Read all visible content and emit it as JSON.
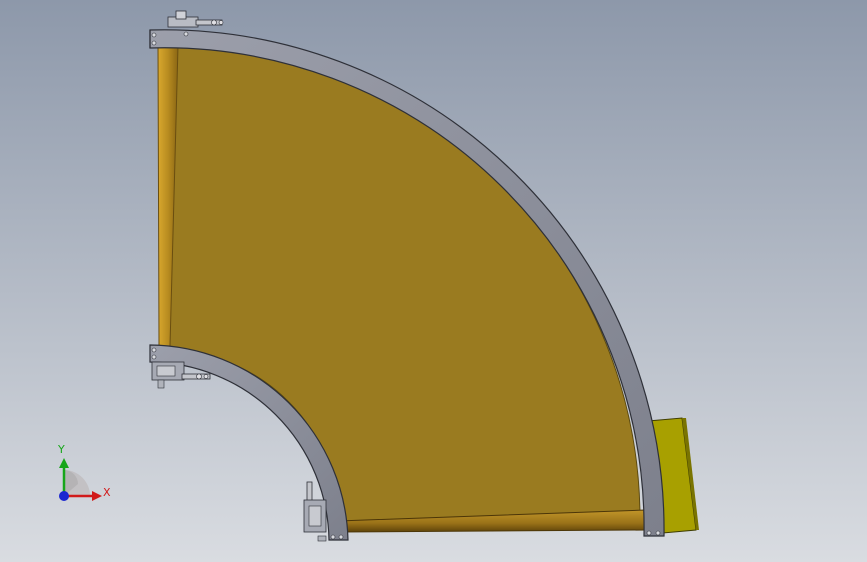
{
  "viewport": {
    "background_top": "#8d98aa",
    "background_bottom": "#d9dce1"
  },
  "model": {
    "belt_color": "#9a7b20",
    "frame_color": "#8c8f9b",
    "roller_color": "#b88c20",
    "guard_color": "#a8a000"
  },
  "triad": {
    "y_label": "Y",
    "x_label": "X",
    "y_color": "#17a61a",
    "x_color": "#d11a1a",
    "z_color": "#1a26d0"
  }
}
